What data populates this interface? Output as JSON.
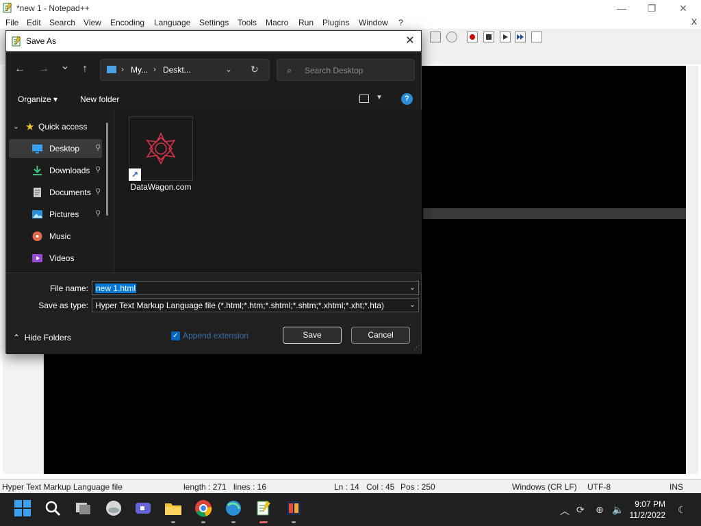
{
  "notepad": {
    "title": "*new 1 - Notepad++",
    "menu": [
      "File",
      "Edit",
      "Search",
      "View",
      "Encoding",
      "Language",
      "Settings",
      "Tools",
      "Macro",
      "Run",
      "Plugins",
      "Window",
      "?"
    ],
    "menu_close": "X",
    "window_controls": {
      "minimize": "—",
      "maximize": "❐",
      "close": "✕"
    },
    "status": {
      "file_type": "Hyper Text Markup Language file",
      "length": "length : 271",
      "lines": "lines : 16",
      "ln": "Ln : 14",
      "col": "Col : 45",
      "pos": "Pos : 250",
      "eol": "Windows (CR LF)",
      "encoding": "UTF-8",
      "mode": "INS"
    }
  },
  "dialog": {
    "title": "Save As",
    "close_icon": "✕",
    "nav": {
      "back": "←",
      "forward": "→",
      "recent": "⌄",
      "up": "↑"
    },
    "address": {
      "segments": [
        "My...",
        "Deskt..."
      ],
      "separator": "›",
      "dropdown": "⌄",
      "refresh": "↻"
    },
    "search": {
      "placeholder": "Search Desktop",
      "icon": "⌕"
    },
    "commands": {
      "organize": "Organize ▾",
      "new_folder": "New folder",
      "help": "?"
    },
    "sidebar": {
      "quick_access": "Quick access",
      "items": [
        {
          "label": "Desktop",
          "icon": "desktop-icon",
          "pinned": true,
          "selected": true
        },
        {
          "label": "Downloads",
          "icon": "download-icon",
          "pinned": true
        },
        {
          "label": "Documents",
          "icon": "document-icon",
          "pinned": true
        },
        {
          "label": "Pictures",
          "icon": "picture-icon",
          "pinned": true
        },
        {
          "label": "Music",
          "icon": "music-icon",
          "pinned": false
        },
        {
          "label": "Videos",
          "icon": "video-icon",
          "pinned": false
        }
      ],
      "pin_glyph": "📌"
    },
    "files": [
      {
        "name": "DataWagon.com",
        "type": "shortcut"
      }
    ],
    "file_name_label": "File name:",
    "file_name_value": "new 1.html",
    "save_type_label": "Save as type:",
    "save_type_value": "Hyper Text Markup Language file (*.html;*.htm;*.shtml;*.shtm;*.xhtml;*.xht;*.hta)",
    "hide_folders": "Hide Folders",
    "append_extension": "Append extension",
    "append_checked": true,
    "save_button": "Save",
    "cancel_button": "Cancel",
    "accent": "#0078d7"
  },
  "taskbar": {
    "clock_time": "9:07 PM",
    "clock_date": "11/2/2022",
    "apps": [
      "start-icon",
      "search-icon",
      "file-manager-icon",
      "cloud-icon",
      "video-chat-icon",
      "folder-icon",
      "chrome-icon",
      "browser-icon",
      "notepadpp-icon",
      "app-icon"
    ]
  }
}
